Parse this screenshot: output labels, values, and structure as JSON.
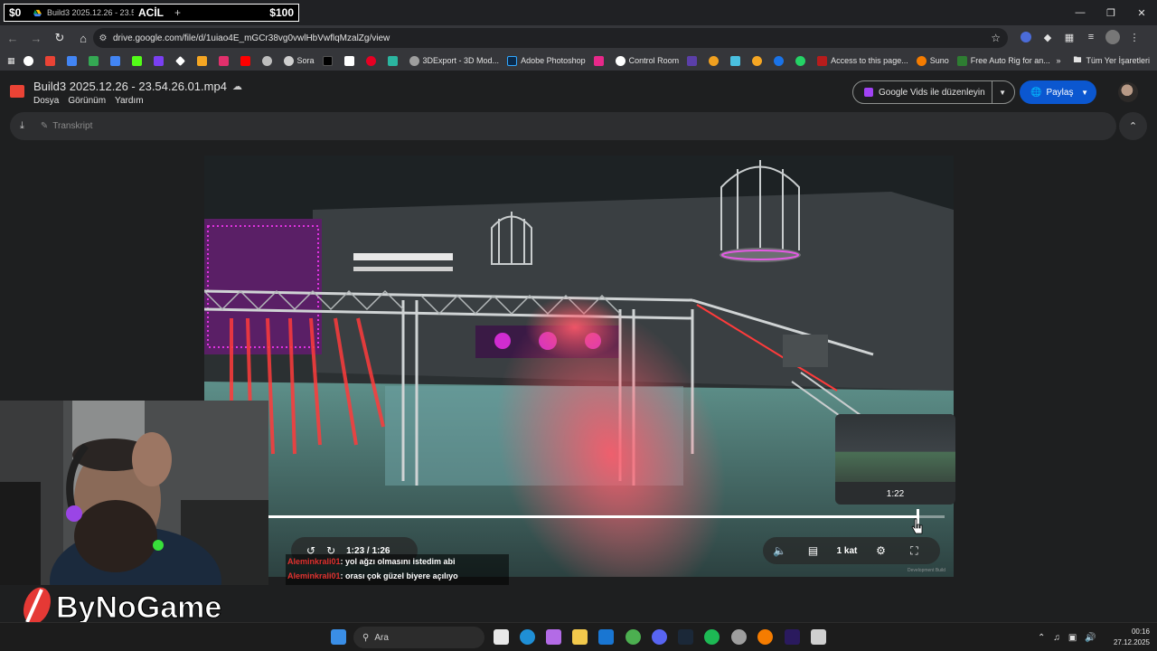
{
  "browser": {
    "overlay_money_left": "$0",
    "tab_title": "Build3 2025.12.26 - 23.54.26.01.mp4",
    "overlay_label": "ACİL",
    "overlay_money_right": "$100",
    "new_tab": "+",
    "url": "drive.google.com/file/d/1uiao4E_mGCr38vg0vwlHbVwflqMzalZg/view"
  },
  "bookmarks": {
    "items": [
      "Sora",
      "3DExport - 3D Mod...",
      "Adobe Photoshop",
      "Control Room",
      "Access to this page...",
      "Suno",
      "Free Auto Rig for an..."
    ],
    "all_bookmarks": "Tüm Yer İşaretleri"
  },
  "drive": {
    "file_name": "Build3 2025.12.26 - 23.54.26.01.mp4",
    "menu": [
      "Dosya",
      "Görünüm",
      "Yardım"
    ],
    "vids_button": "Google Vids ile düzenleyin",
    "share_button": "Paylaş",
    "transcript": "Transkript"
  },
  "player": {
    "current_time": "1:23",
    "total_time": "/ 1:26",
    "hover_time": "1:22",
    "progress_fraction": 0.96,
    "speed": "1 kat",
    "watermark": "Development Build"
  },
  "chat": [
    {
      "user": "Aleminkrali01",
      "message": ": yol ağzı olmasını istedim abi"
    },
    {
      "user": "Aleminkrali01",
      "message": ": orası çok güzel biyere açılıyo"
    }
  ],
  "stream": {
    "brand": "ByNoGame"
  },
  "taskbar": {
    "search": "Ara",
    "time": "00:16",
    "date": "27.12.2025"
  },
  "colors": {
    "accent_blue": "#0b57d0",
    "chat_user_red": "#e0322f",
    "laser_red": "#ff3b3b",
    "neon_magenta": "#e033e0"
  }
}
